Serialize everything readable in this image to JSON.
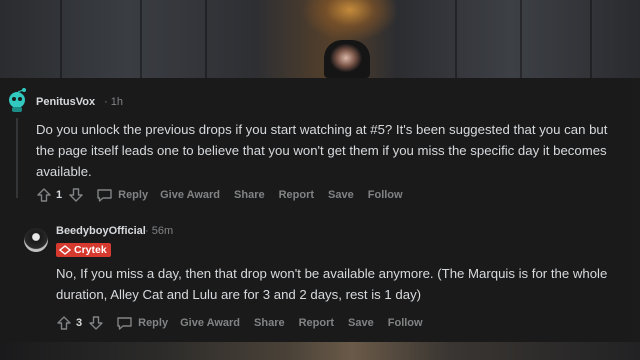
{
  "comments": [
    {
      "username": "PenitusVox",
      "separator": "·",
      "time": "1h",
      "body": "Do you unlock the previous drops if you start watching at #5? It's been suggested that you can but the page itself leads one to believe that you won't get them if you miss the specific day it becomes available.",
      "votes": "1",
      "actions": {
        "reply": "Reply",
        "give_award": "Give Award",
        "share": "Share",
        "report": "Report",
        "save": "Save",
        "follow": "Follow"
      }
    },
    {
      "username": "BeedyboyOfficial",
      "separator": "·",
      "time": "56m",
      "flair": "Crytek",
      "body": "No, If you miss a day, then that drop won't be available anymore. (The Marquis is for the whole duration, Alley Cat and Lulu are for 3 and 2 days, rest is 1 day)",
      "votes": "3",
      "actions": {
        "reply": "Reply",
        "give_award": "Give Award",
        "share": "Share",
        "report": "Report",
        "save": "Save",
        "follow": "Follow"
      }
    }
  ],
  "colors": {
    "panel_bg": "#1a1a1b",
    "text": "#d7dadc",
    "muted": "#818384",
    "flair_bg": "#d63a2f",
    "snoo_teal": "#31c9c0"
  },
  "icons": [
    "snoo-avatar-icon",
    "upvote-icon",
    "downvote-icon",
    "reply-bubble-icon",
    "crytek-logo-icon"
  ]
}
